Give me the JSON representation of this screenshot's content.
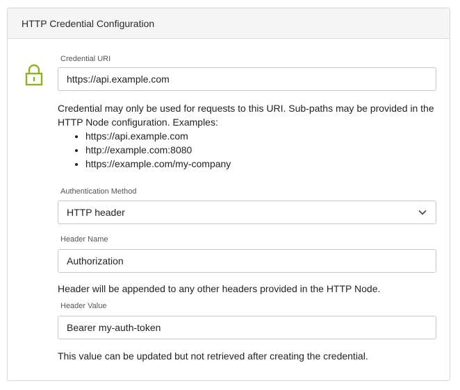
{
  "panel": {
    "title": "HTTP Credential Configuration"
  },
  "icons": {
    "lock": "lock-icon",
    "lock_color": "#8db31f"
  },
  "credential_uri": {
    "label": "Credential URI",
    "value": "https://api.example.com",
    "help_text": "Credential may only be used for requests to this URI. Sub-paths may be provided in the HTTP Node configuration. Examples:",
    "examples": [
      "https://api.example.com",
      "http://example.com:8080",
      "https://example.com/my-company"
    ]
  },
  "auth_method": {
    "label": "Authentication Method",
    "selected": "HTTP header"
  },
  "header_name": {
    "label": "Header Name",
    "value": "Authorization",
    "help_text": "Header will be appended to any other headers provided in the HTTP Node."
  },
  "header_value": {
    "label": "Header Value",
    "value": "Bearer my-auth-token",
    "help_text": "This value can be updated but not retrieved after creating the credential."
  }
}
